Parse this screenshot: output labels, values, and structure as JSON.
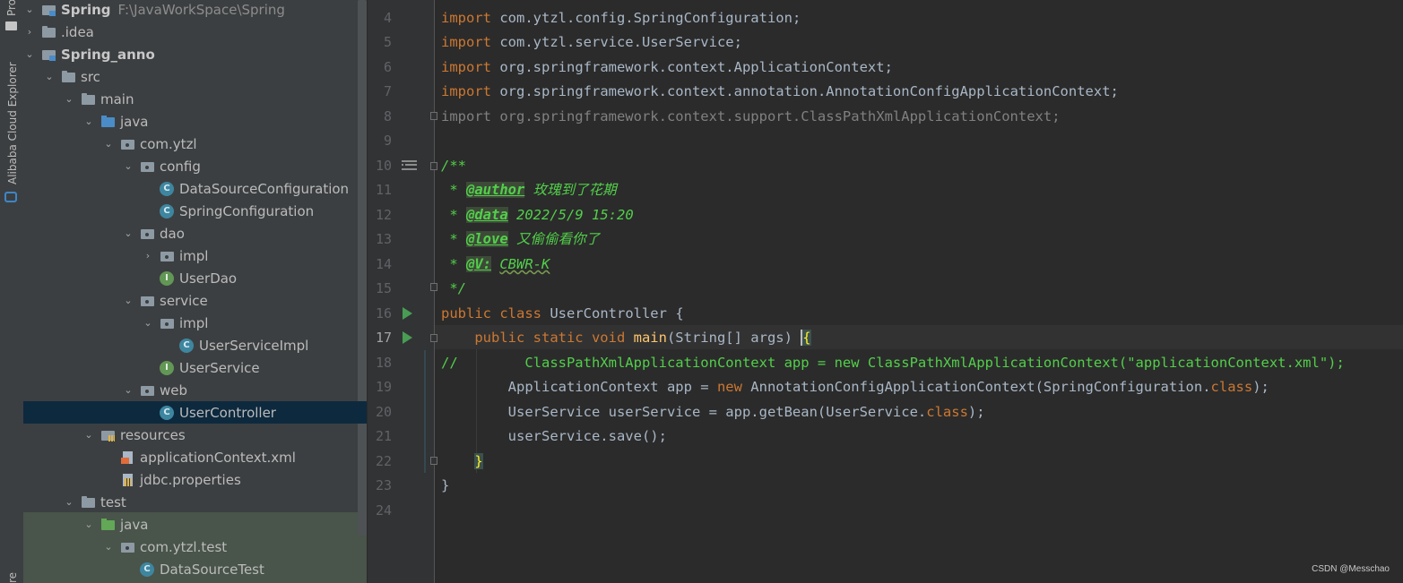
{
  "toolstripe": {
    "project_label": "Pro",
    "alibaba_label": "Alibaba Cloud Explorer",
    "bottom_label": "re"
  },
  "tree": {
    "root_name": "Spring",
    "root_path": "F:\\JavaWorkSpace\\Spring",
    "idea": ".idea",
    "module": "Spring_anno",
    "src": "src",
    "main": "main",
    "java": "java",
    "pkg": "com.ytzl",
    "config": "config",
    "ds_config": "DataSourceConfiguration",
    "spring_config": "SpringConfiguration",
    "dao": "dao",
    "dao_impl": "impl",
    "user_dao": "UserDao",
    "service": "service",
    "service_impl": "impl",
    "user_service_impl": "UserServiceImpl",
    "user_service": "UserService",
    "web": "web",
    "user_controller": "UserController",
    "resources": "resources",
    "app_ctx_xml": "applicationContext.xml",
    "jdbc_props": "jdbc.properties",
    "test": "test",
    "test_java": "java",
    "test_pkg": "com.ytzl.test",
    "ds_test": "DataSourceTest"
  },
  "editor": {
    "line_numbers": [
      "4",
      "5",
      "6",
      "7",
      "8",
      "9",
      "10",
      "11",
      "12",
      "13",
      "14",
      "15",
      "16",
      "17",
      "18",
      "19",
      "20",
      "21",
      "22",
      "23",
      "24"
    ],
    "current_line": "17",
    "code": {
      "import_kw": "import",
      "l4": " com.ytzl.config.SpringConfiguration;",
      "l5": " com.ytzl.service.UserService;",
      "l6": " org.springframework.context.ApplicationContext;",
      "l7": " org.springframework.context.annotation.AnnotationConfigApplicationContext;",
      "l8": "import org.springframework.context.support.ClassPathXmlApplicationContext;",
      "l10": "/**",
      "doc_star": " * ",
      "author_tag": "@author",
      "author_val": " 玫瑰到了花期",
      "data_tag": "@data",
      "data_val": " 2022/5/9 15:20",
      "love_tag": "@love",
      "love_val": " 又偷偷看你了",
      "v_tag": "@V:",
      "v_val": "CBWR-K",
      "l15": " */",
      "public_class": "public class ",
      "class_name": "UserController",
      "l16_tail": " {",
      "l17_mods": "    public static void ",
      "main_fn": "main",
      "l17_args": "(String[] args) ",
      "open_brace": "{",
      "l18": "//        ClassPathXmlApplicationContext app = new ClassPathXmlApplicationContext(\"applicationContext.xml\");",
      "l19_a": "        ApplicationContext app = ",
      "new_kw": "new",
      "l19_b": " AnnotationConfigApplicationContext(SpringConfiguration.",
      "class_kw": "class",
      "l19_c": ");",
      "l20_a": "        UserService userService = app.getBean(UserService.",
      "l20_c": ");",
      "l21": "        userService.save();",
      "close_brace_inner": "}",
      "close_brace_outer": "}"
    }
  },
  "watermark": "CSDN @Messchao",
  "colors": {
    "background": "#2b2b2b",
    "keyword": "#cc7832",
    "function": "#ffc66d",
    "doc_comment": "#52cf4a",
    "run_icon": "#499c54",
    "selection": "#0d293e"
  }
}
